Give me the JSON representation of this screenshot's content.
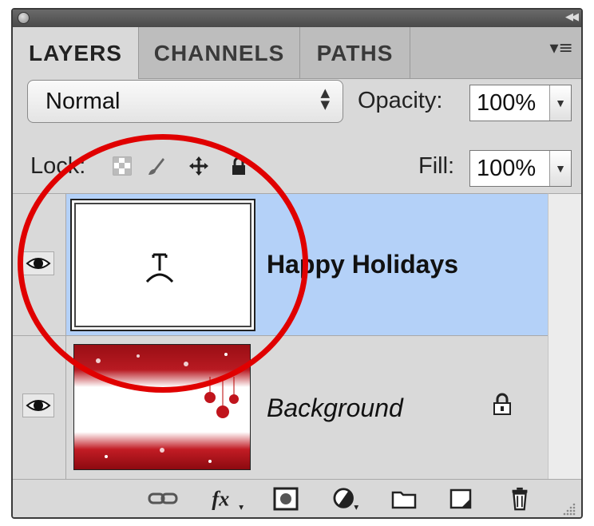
{
  "tabs": [
    "LAYERS",
    "CHANNELS",
    "PATHS"
  ],
  "blend_mode": "Normal",
  "opacity": {
    "label": "Opacity:",
    "value": "100%"
  },
  "lock": {
    "label": "Lock:"
  },
  "fill": {
    "label": "Fill:",
    "value": "100%"
  },
  "layers": [
    {
      "name": "Happy Holidays",
      "selected": true,
      "visible": true,
      "type": "text"
    },
    {
      "name": "Background",
      "selected": false,
      "visible": true,
      "locked": true
    }
  ],
  "colors": {
    "selection": "#b4d1f8",
    "panel": "#d9d9d9",
    "annotation_circle": "#e00000"
  },
  "icons": [
    "eye-icon",
    "lock-transparent-icon",
    "lock-paint-icon",
    "lock-move-icon",
    "lock-all-icon",
    "link-layers-icon",
    "fx-icon",
    "layer-mask-icon",
    "adjustment-layer-icon",
    "new-group-icon",
    "new-layer-icon",
    "trash-icon"
  ]
}
